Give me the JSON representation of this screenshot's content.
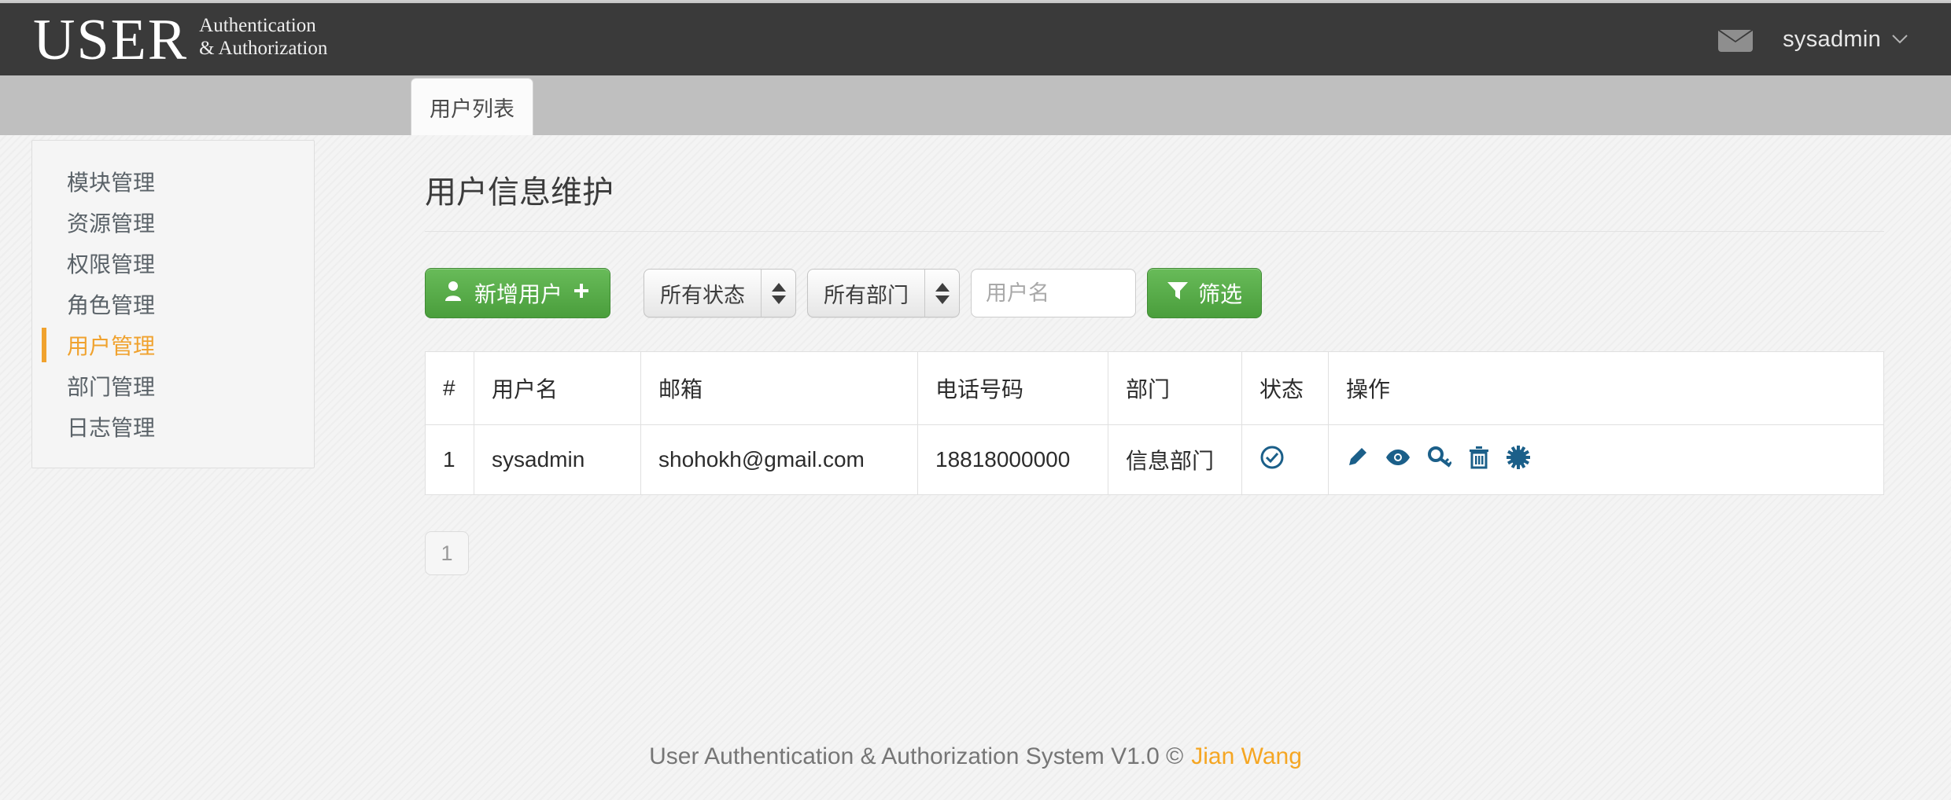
{
  "header": {
    "brand_main": "USER",
    "brand_line1": "Authentication",
    "brand_line2": "& Authorization",
    "mail_icon": "envelope-icon",
    "user": "sysadmin",
    "caret_icon": "chevron-down-icon",
    "bg_color": "#3a3a3a"
  },
  "tabs": [
    {
      "label": "用户列表",
      "active": true
    }
  ],
  "sidebar": {
    "items": [
      {
        "label": "模块管理",
        "active": false
      },
      {
        "label": "资源管理",
        "active": false
      },
      {
        "label": "权限管理",
        "active": false
      },
      {
        "label": "角色管理",
        "active": false
      },
      {
        "label": "用户管理",
        "active": true
      },
      {
        "label": "部门管理",
        "active": false
      },
      {
        "label": "日志管理",
        "active": false
      }
    ],
    "active_color": "#f0a22e"
  },
  "main": {
    "page_title": "用户信息维护",
    "toolbar": {
      "add_user_label": "新增用户",
      "add_user_icon": "user-plus-icon",
      "status_select": {
        "value": "所有状态",
        "options": [
          "所有状态"
        ]
      },
      "dept_select": {
        "value": "所有部门",
        "options": [
          "所有部门"
        ]
      },
      "search_placeholder": "用户名",
      "search_value": "",
      "filter_label": "筛选",
      "filter_icon": "funnel-icon",
      "button_color": "#4a9e3c"
    },
    "table": {
      "columns": [
        "#",
        "用户名",
        "邮箱",
        "电话号码",
        "部门",
        "状态",
        "操作"
      ],
      "rows": [
        {
          "index": "1",
          "username": "sysadmin",
          "email": "shohokh@gmail.com",
          "phone": "18818000000",
          "department": "信息部门",
          "status_icon": "check-circle-icon",
          "actions": [
            "edit-pencil-icon",
            "view-eye-icon",
            "key-icon",
            "delete-trash-icon",
            "gear-starburst-icon"
          ]
        }
      ],
      "icon_color": "#1b5f89"
    },
    "pagination": {
      "pages": [
        "1"
      ],
      "current": "1"
    }
  },
  "footer": {
    "text": "User Authentication & Authorization System V1.0 ©",
    "author": "Jian Wang",
    "author_color": "#f5a623"
  }
}
